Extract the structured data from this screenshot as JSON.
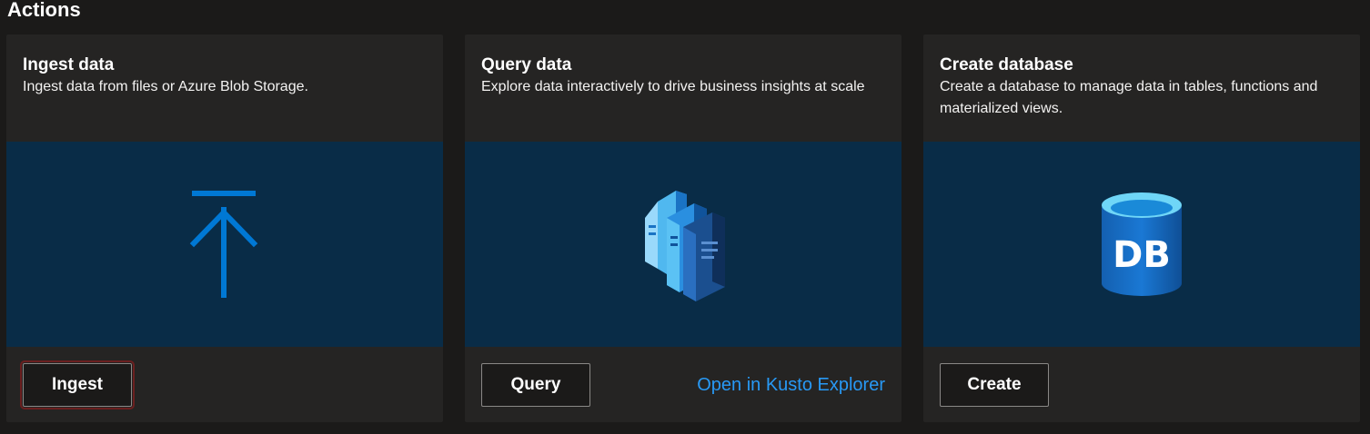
{
  "section": {
    "title": "Actions"
  },
  "cards": [
    {
      "title": "Ingest data",
      "description": "Ingest data from files or Azure Blob Storage.",
      "icon": "upload-arrow-icon",
      "button_label": "Ingest"
    },
    {
      "title": "Query data",
      "description": "Explore data interactively to drive business insights at scale",
      "icon": "query-documents-icon",
      "button_label": "Query",
      "link_label": "Open in Kusto Explorer"
    },
    {
      "title": "Create database",
      "description": "Create a database to manage data in tables, functions and materialized views.",
      "icon": "database-icon",
      "icon_text": "DB",
      "button_label": "Create"
    }
  ],
  "colors": {
    "page_background": "#1b1a19",
    "card_background": "#252423",
    "media_background": "#092c47",
    "accent_blue": "#0078d4",
    "link_blue": "#2899f5"
  }
}
